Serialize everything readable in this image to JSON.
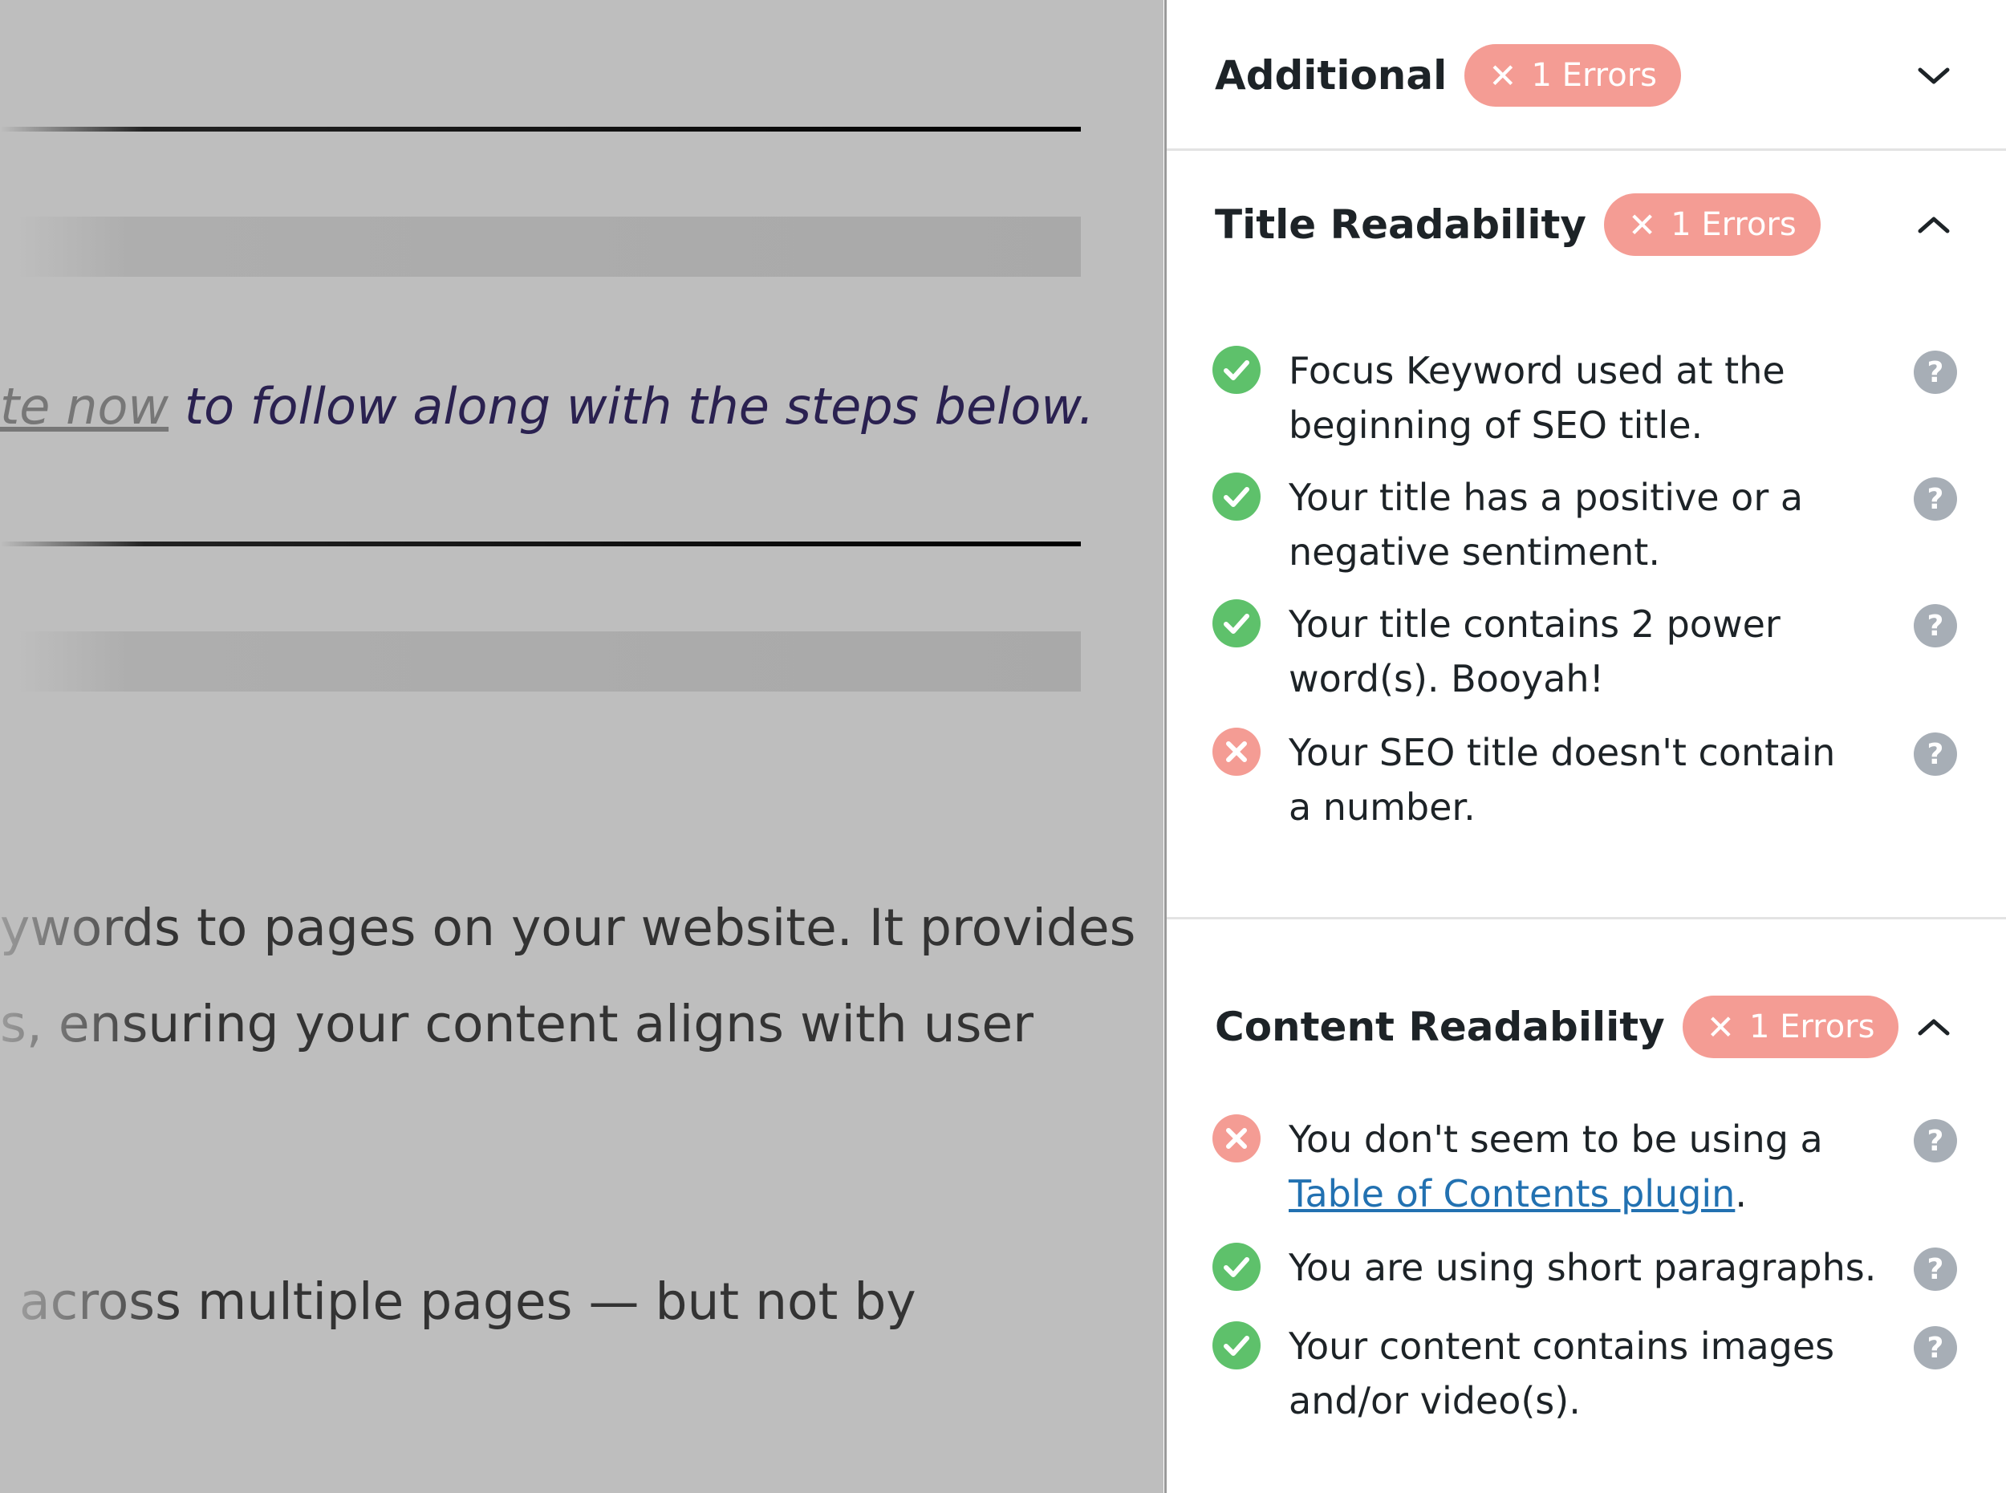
{
  "editor": {
    "italic_prefix": "te now",
    "italic_rest": " to follow along with the steps below.",
    "para1_line1": "ywords to pages on your website. It provides",
    "para1_line2": "s, ensuring your content aligns with user",
    "para2_line1": "across multiple pages — but not by"
  },
  "panel": {
    "colors": {
      "error": "#f49c94",
      "success": "#5ec16b",
      "help": "#a7aeb6",
      "link": "#2271b1"
    },
    "sections": [
      {
        "title": "Additional",
        "badge": {
          "icon": "x-icon",
          "label": "1 Errors"
        },
        "state": "collapsed"
      },
      {
        "title": "Title Readability",
        "badge": {
          "icon": "x-icon",
          "label": "1 Errors"
        },
        "state": "expanded",
        "items": [
          {
            "status": "pass",
            "text": "Focus Keyword used at the beginning of SEO title."
          },
          {
            "status": "pass",
            "text": "Your title has a positive or a negative sentiment."
          },
          {
            "status": "pass",
            "text": "Your title contains 2 power word(s). Booyah!"
          },
          {
            "status": "fail",
            "text": "Your SEO title doesn't contain a number."
          }
        ]
      },
      {
        "title": "Content Readability",
        "badge": {
          "icon": "x-icon",
          "label": "1 Errors"
        },
        "state": "expanded",
        "items": [
          {
            "status": "fail",
            "text_before": "You don't seem to be using a ",
            "link": "Table of Contents plugin",
            "text_after": "."
          },
          {
            "status": "pass",
            "text": "You are using short paragraphs."
          },
          {
            "status": "pass",
            "text": "Your content contains images and/or video(s)."
          }
        ]
      }
    ]
  }
}
